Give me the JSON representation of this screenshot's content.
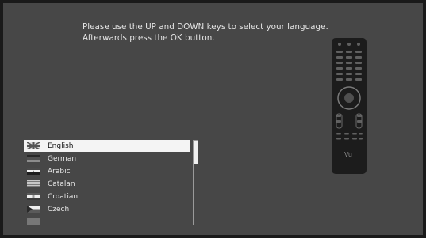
{
  "instructions": {
    "line1": "Please use the UP and DOWN keys to select your language.",
    "line2": "Afterwards press the OK button."
  },
  "languages": [
    {
      "label": "English",
      "selected": true
    },
    {
      "label": "German",
      "selected": false
    },
    {
      "label": "Arabic",
      "selected": false
    },
    {
      "label": "Catalan",
      "selected": false
    },
    {
      "label": "Croatian",
      "selected": false
    },
    {
      "label": "Czech",
      "selected": false
    }
  ],
  "remote": {
    "brand": "Vu"
  },
  "colors": {
    "background": "#474747",
    "text": "#e4e4e4",
    "selection": "#f4f4f4"
  }
}
